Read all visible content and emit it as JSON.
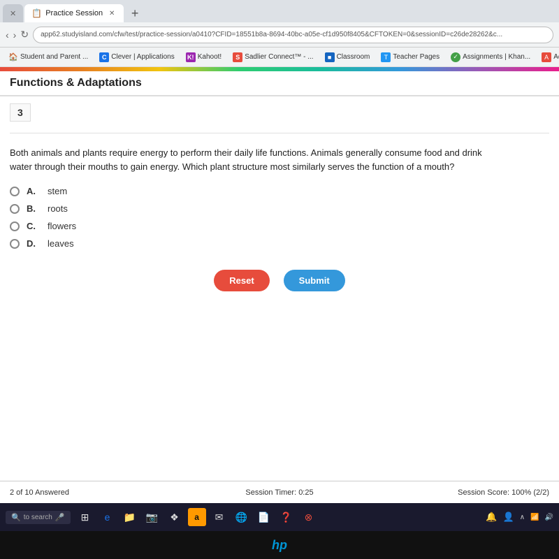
{
  "browser": {
    "tabs": [
      {
        "id": "tab-x",
        "label": "x",
        "active": false
      },
      {
        "id": "tab-practice",
        "label": "Practice Session",
        "active": true,
        "favicon": "📋"
      },
      {
        "id": "tab-add",
        "label": "+",
        "active": false
      }
    ],
    "address": "app62.studyisland.com/cfw/test/practice-session/a0410?CFID=18551b8a-8694-40bc-a05e-cf1d950f8405&CFTOKEN=0&sessionID=c26de28262&c...",
    "bookmarks": [
      {
        "label": "Student and Parent ...",
        "icon": ""
      },
      {
        "label": "Clever | Applications",
        "icon": "C",
        "color": "#1a73e8"
      },
      {
        "label": "Kahoot!",
        "icon": "K",
        "color": "#9c27b0"
      },
      {
        "label": "Sadlier Connect™ - ...",
        "icon": "S",
        "color": "#e74c3c"
      },
      {
        "label": "Classroom",
        "icon": "■",
        "color": "#1565c0"
      },
      {
        "label": "Teacher Pages",
        "icon": "T",
        "color": "#2196f3"
      },
      {
        "label": "Assignments | Khan...",
        "icon": "✓",
        "color": "#43a047"
      },
      {
        "label": "Active",
        "icon": "A",
        "color": "#e74c3c"
      }
    ]
  },
  "page": {
    "title": "Functions & Adaptations",
    "question_number": "3",
    "question_text": "Both animals and plants require energy to perform their daily life functions. Animals generally consume food and drink water through their mouths to gain energy. Which plant structure most similarly serves the function of a mouth?",
    "options": [
      {
        "letter": "A.",
        "text": "stem"
      },
      {
        "letter": "B.",
        "text": "roots"
      },
      {
        "letter": "C.",
        "text": "flowers"
      },
      {
        "letter": "D.",
        "text": "leaves"
      }
    ],
    "buttons": {
      "reset": "Reset",
      "submit": "Submit"
    }
  },
  "status": {
    "answered": "2 of 10 Answered",
    "timer_label": "Session Timer:",
    "timer_value": "0:25",
    "score_label": "Session Score:",
    "score_value": "100% (2/2)"
  },
  "taskbar": {
    "search_placeholder": "to search",
    "icons": [
      "⊞",
      "e",
      "📁",
      "📷",
      "❖",
      "a",
      "✉",
      "🌐",
      "📄",
      "❓",
      "⊗"
    ]
  }
}
